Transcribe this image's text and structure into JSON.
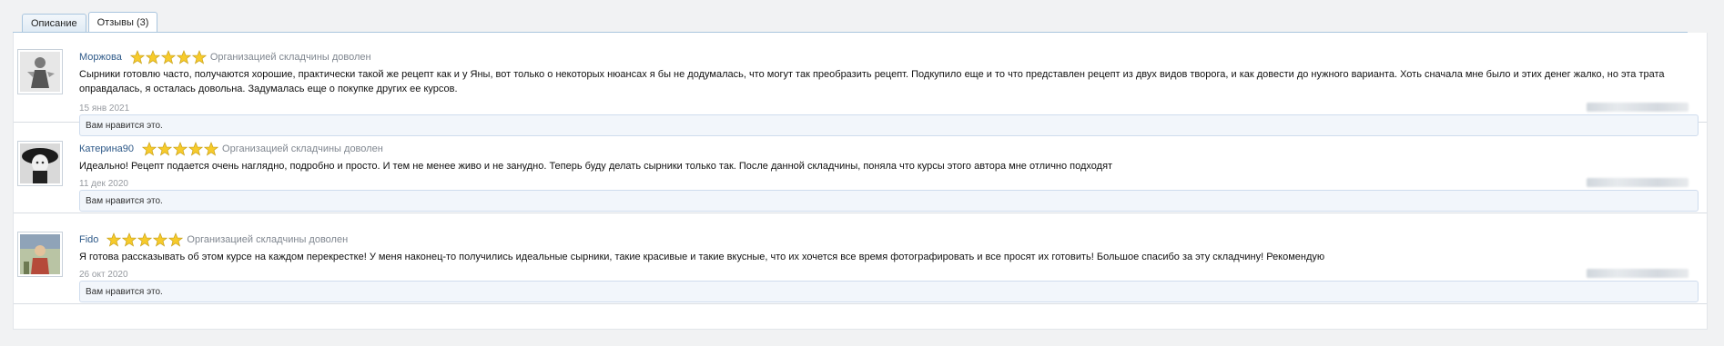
{
  "tabs": [
    {
      "label": "Описание",
      "active": false
    },
    {
      "label": "Отзывы (3)",
      "active": true
    }
  ],
  "reviews": [
    {
      "username": "Моржова",
      "rating_text": "Организацией складчины доволен",
      "stars": 5,
      "text": "Сырники готовлю часто, получаются хорошие, практически такой же рецепт как и у Яны, вот только о некоторых нюансах я бы не додумалась, что могут так преобразить рецепт. Подкупило еще и то что представлен рецепт из двух видов творога, и как довести до нужного варианта. Хоть сначала мне было и этих денег жалко, но эта трата оправдалась, я осталась довольна. Задумалась еще о покупке других ее курсов.",
      "date": "15 янв 2021",
      "likes_text": "Вам нравится это."
    },
    {
      "username": "Катерина90",
      "rating_text": "Организацией складчины доволен",
      "stars": 5,
      "text": "Идеально! Рецепт подается очень наглядно, подробно и просто. И тем не менее живо и не занудно. Теперь буду делать сырники только так. После данной складчины, поняла что курсы этого автора мне отлично подходят",
      "date": "11 дек 2020",
      "likes_text": "Вам нравится это."
    },
    {
      "username": "Fido",
      "rating_text": "Организацией складчины доволен",
      "stars": 5,
      "text": "Я готова рассказывать об этом курсе на каждом перекрестке! У меня наконец-то получились идеальные сырники, такие красивые и такие вкусные, что их хочется все время фотографировать и все просят их готовить! Большое спасибо за эту складчину! Рекомендую",
      "date": "26 окт 2020",
      "likes_text": "Вам нравится это."
    }
  ],
  "colors": {
    "username": "#2f5a89",
    "star_fill": "#f7cb2b",
    "tab_border": "#a9c5de",
    "likes_bg": "#f2f6fb"
  },
  "icons": {
    "star": "star-icon"
  }
}
